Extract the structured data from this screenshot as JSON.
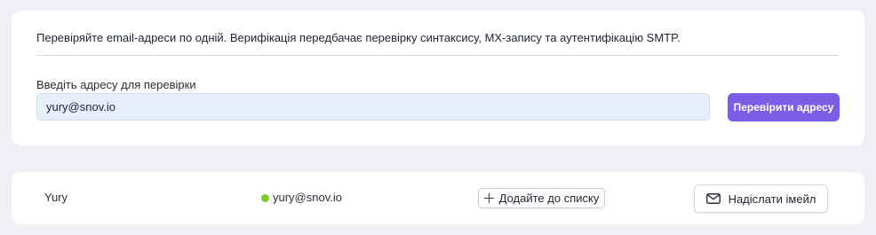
{
  "verify": {
    "description": "Перевіряйте email-адреси по одній. Верифікація передбачає перевірку синтаксису, MX-запису та аутентифікацію SMTP.",
    "field_label": "Введіть адресу для перевірки",
    "input_value": "yury@snov.io",
    "button_label": "Перевірити адресу"
  },
  "result": {
    "name": "Yury",
    "email": "yury@snov.io",
    "status_color": "#7ccb2a",
    "add_to_list_label": "Додайте до списку",
    "add_icon": "plus-icon",
    "send_email_label": "Надіслати імейл",
    "send_icon": "mail-icon"
  },
  "colors": {
    "accent": "#7b5ee6",
    "background": "#eef0f6",
    "input_background": "#e8eefb"
  }
}
